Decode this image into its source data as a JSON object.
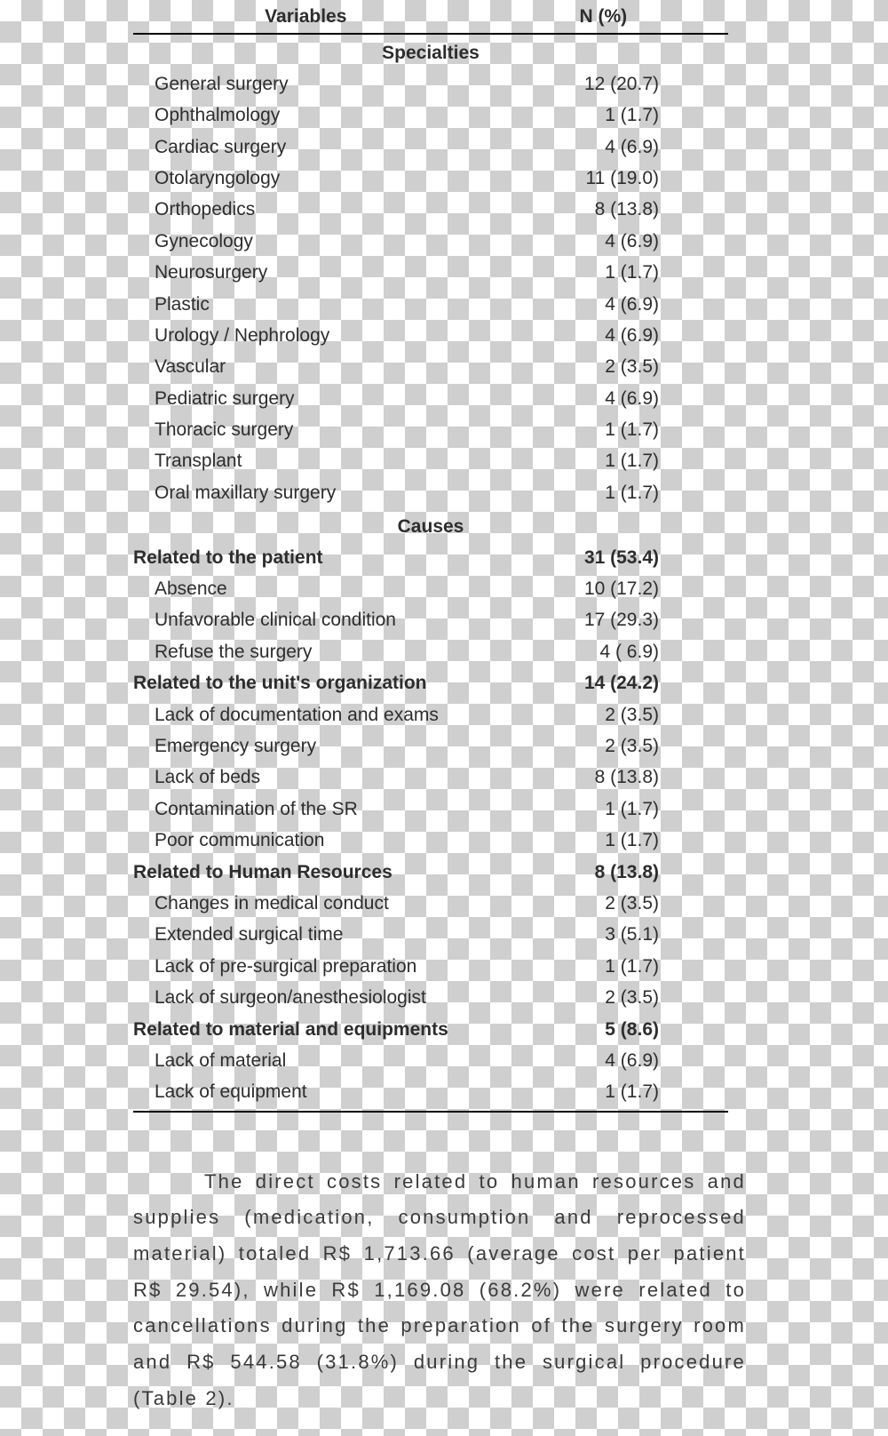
{
  "table": {
    "header_left": "Variables",
    "header_right": "N (%)",
    "section1_title": "Specialties",
    "section2_title": "Causes",
    "rows": [
      {
        "section": 1,
        "label": "General surgery",
        "value": "12 (20.7)",
        "bold": false
      },
      {
        "section": 1,
        "label": "Ophthalmology",
        "value": "1 (1.7)",
        "bold": false
      },
      {
        "section": 1,
        "label": "Cardiac surgery",
        "value": "4 (6.9)",
        "bold": false
      },
      {
        "section": 1,
        "label": "Otolaryngology",
        "value": "11 (19.0)",
        "bold": false
      },
      {
        "section": 1,
        "label": "Orthopedics",
        "value": "8 (13.8)",
        "bold": false
      },
      {
        "section": 1,
        "label": "Gynecology",
        "value": "4 (6.9)",
        "bold": false
      },
      {
        "section": 1,
        "label": "Neurosurgery",
        "value": "1 (1.7)",
        "bold": false
      },
      {
        "section": 1,
        "label": "Plastic",
        "value": "4 (6.9)",
        "bold": false
      },
      {
        "section": 1,
        "label": "Urology / Nephrology",
        "value": "4 (6.9)",
        "bold": false
      },
      {
        "section": 1,
        "label": "Vascular",
        "value": "2 (3.5)",
        "bold": false
      },
      {
        "section": 1,
        "label": "Pediatric surgery",
        "value": "4 (6.9)",
        "bold": false
      },
      {
        "section": 1,
        "label": "Thoracic surgery",
        "value": "1 (1.7)",
        "bold": false
      },
      {
        "section": 1,
        "label": "Transplant",
        "value": "1 (1.7)",
        "bold": false
      },
      {
        "section": 1,
        "label": "Oral maxillary surgery",
        "value": "1 (1.7)",
        "bold": false
      },
      {
        "section": 2,
        "label": "Related to the patient",
        "value": "31 (53.4)",
        "bold": true
      },
      {
        "section": 2,
        "label": "Absence",
        "value": "10 (17.2)",
        "bold": false
      },
      {
        "section": 2,
        "label": "Unfavorable clinical condition",
        "value": "17 (29.3)",
        "bold": false
      },
      {
        "section": 2,
        "label": "Refuse the surgery",
        "value": "4 ( 6.9)",
        "bold": false
      },
      {
        "section": 2,
        "label": "Related to the unit's organization",
        "value": "14 (24.2)",
        "bold": true
      },
      {
        "section": 2,
        "label": "Lack of documentation and exams",
        "value": "2 (3.5)",
        "bold": false
      },
      {
        "section": 2,
        "label": "Emergency surgery",
        "value": "2 (3.5)",
        "bold": false
      },
      {
        "section": 2,
        "label": "Lack of beds",
        "value": "8 (13.8)",
        "bold": false
      },
      {
        "section": 2,
        "label": "Contamination of the SR",
        "value": "1 (1.7)",
        "bold": false
      },
      {
        "section": 2,
        "label": "Poor communication",
        "value": "1 (1.7)",
        "bold": false
      },
      {
        "section": 2,
        "label": "Related to Human Resources",
        "value": "8 (13.8)",
        "bold": true
      },
      {
        "section": 2,
        "label": "Changes in medical conduct",
        "value": "2 (3.5)",
        "bold": false
      },
      {
        "section": 2,
        "label": "Extended surgical time",
        "value": "3 (5.1)",
        "bold": false
      },
      {
        "section": 2,
        "label": "Lack of pre-surgical preparation",
        "value": "1 (1.7)",
        "bold": false
      },
      {
        "section": 2,
        "label": "Lack of surgeon/anesthesiologist",
        "value": "2 (3.5)",
        "bold": false
      },
      {
        "section": 2,
        "label": "Related to material and equipments",
        "value": "5 (8.6)",
        "bold": true
      },
      {
        "section": 2,
        "label": "Lack of material",
        "value": "4 (6.9)",
        "bold": false
      },
      {
        "section": 2,
        "label": "Lack of equipment",
        "value": "1 (1.7)",
        "bold": false,
        "last": true
      }
    ]
  },
  "paragraph": "The direct costs related to human resources and supplies (medication, consumption and reprocessed material) totaled R$ 1,713.66 (average cost per patient R$ 29.54), while R$ 1,169.08 (68.2%) were related to cancellations during the preparation of the surgery room and R$ 544.58 (31.8%) during the surgical procedure (Table 2)."
}
